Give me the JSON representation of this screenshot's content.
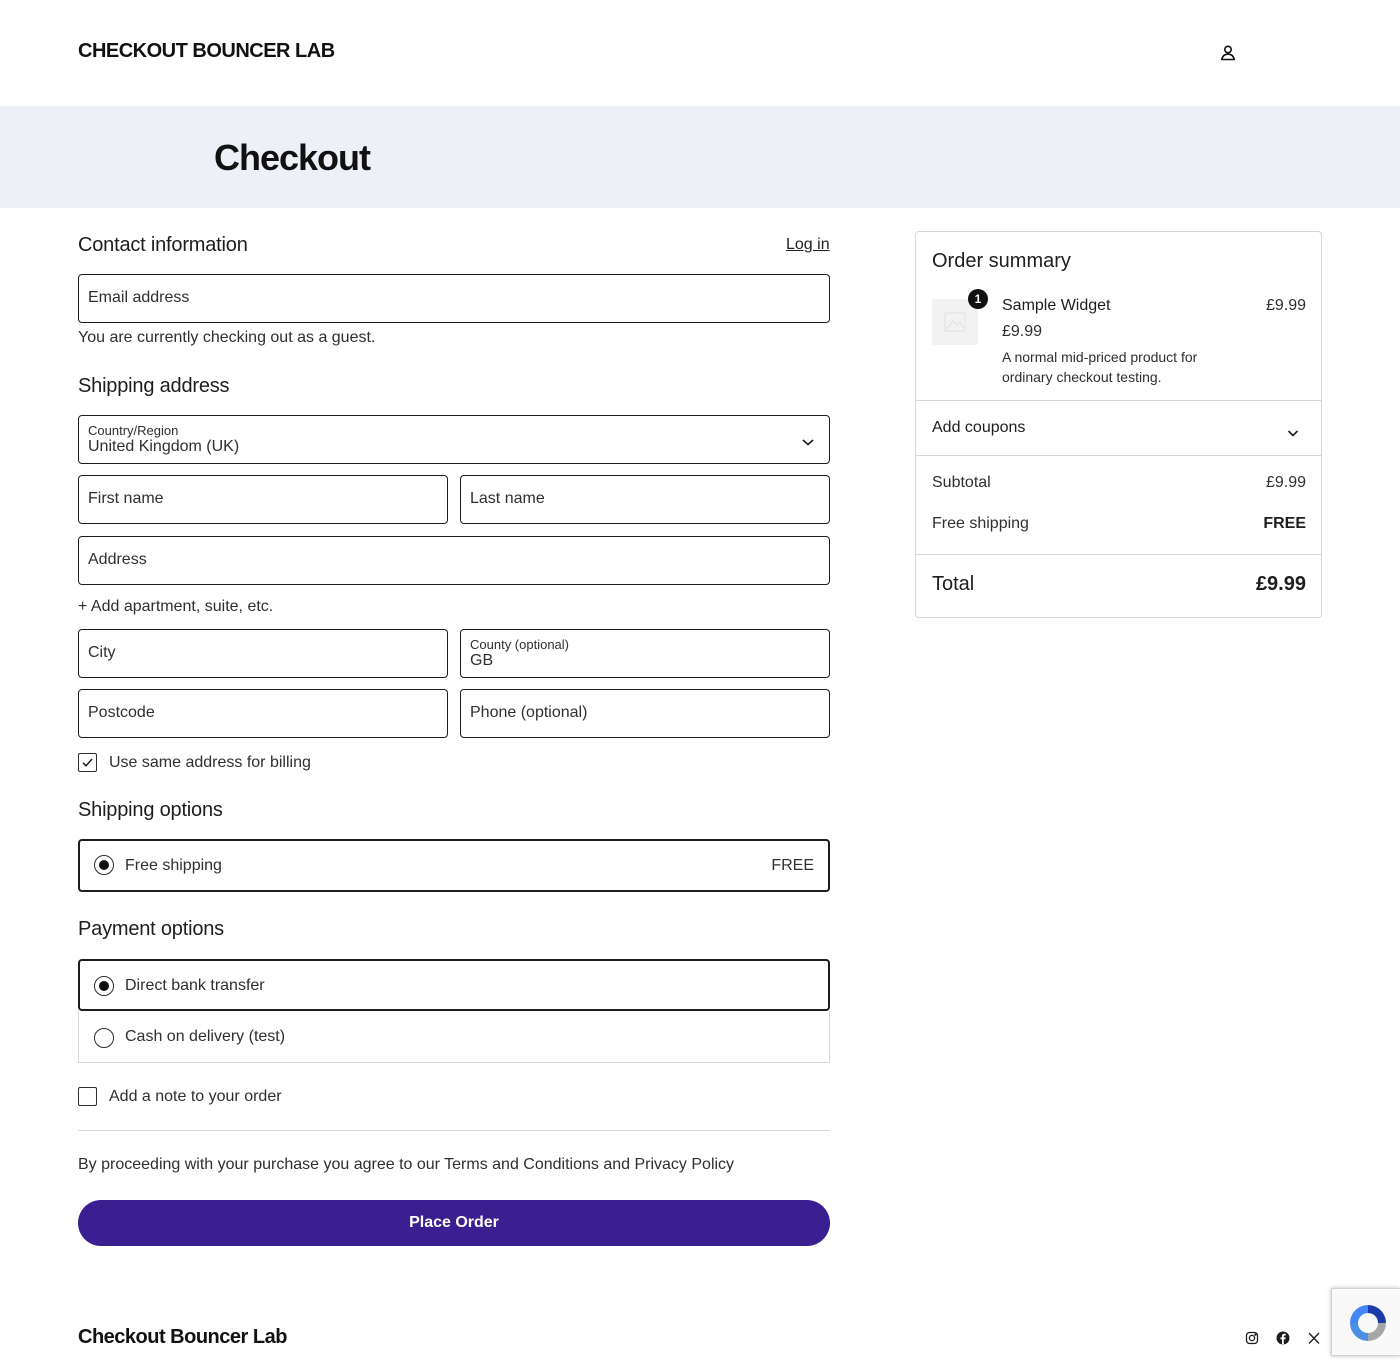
{
  "site": {
    "title": "CHECKOUT BOUNCER LAB",
    "footer_title": "Checkout Bouncer Lab"
  },
  "page": {
    "title": "Checkout"
  },
  "contact": {
    "heading": "Contact information",
    "login_label": "Log in",
    "email_placeholder": "Email address",
    "guest_note": "You are currently checking out as a guest."
  },
  "shipping_address": {
    "heading": "Shipping address",
    "country_label": "Country/Region",
    "country_value": "United Kingdom (UK)",
    "first_name": "First name",
    "last_name": "Last name",
    "address": "Address",
    "add_apartment": "+ Add apartment, suite, etc.",
    "city": "City",
    "county_label": "County (optional)",
    "county_value": "GB",
    "postcode": "Postcode",
    "phone": "Phone (optional)",
    "same_billing_label": "Use same address for billing",
    "same_billing_checked": true
  },
  "shipping_options": {
    "heading": "Shipping options",
    "options": [
      {
        "label": "Free shipping",
        "price": "FREE",
        "selected": true
      }
    ]
  },
  "payment_options": {
    "heading": "Payment options",
    "options": [
      {
        "label": "Direct bank transfer",
        "selected": true
      },
      {
        "label": "Cash on delivery (test)",
        "selected": false
      }
    ]
  },
  "order_note": {
    "label": "Add a note to your order",
    "checked": false
  },
  "terms_text": "By proceeding with your purchase you agree to our Terms and Conditions and Privacy Policy",
  "place_order_label": "Place Order",
  "summary": {
    "title": "Order summary",
    "item": {
      "quantity": "1",
      "name": "Sample Widget",
      "line_total": "£9.99",
      "price": "£9.99",
      "description": "A normal mid-priced product for ordinary checkout testing."
    },
    "coupons_label": "Add coupons",
    "subtotal_label": "Subtotal",
    "subtotal_value": "£9.99",
    "shipping_label": "Free shipping",
    "shipping_value": "FREE",
    "total_label": "Total",
    "total_value": "£9.99"
  },
  "icons": {
    "account": "user-icon",
    "social": [
      "instagram-icon",
      "facebook-icon",
      "x-icon"
    ],
    "recaptcha": "recaptcha-icon"
  },
  "colors": {
    "accent": "#3b1f91",
    "banner_bg": "#eef0f8",
    "text": "#1e1e1e"
  }
}
